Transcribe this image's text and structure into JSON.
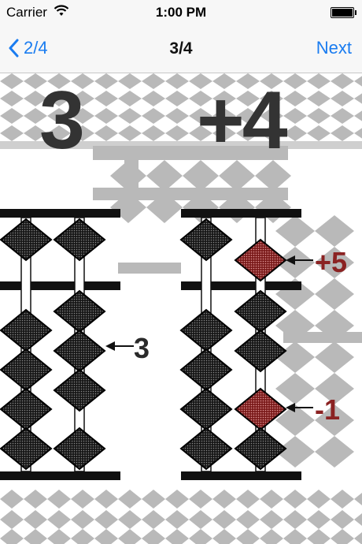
{
  "status_bar": {
    "carrier": "Carrier",
    "time": "1:00 PM"
  },
  "nav": {
    "back_label": "2/4",
    "title": "3/4",
    "next_label": "Next"
  },
  "problem": {
    "first_operand": "3",
    "second_operand": "+4"
  },
  "annotations": {
    "left_rod": "3",
    "upper_bead": "+5",
    "lower_bead": "-1"
  },
  "colors": {
    "accent": "#1a7cf0",
    "bead": "#1c1c1c",
    "moved_bead": "#8b2222",
    "background_pattern": "#b9b9b9"
  }
}
